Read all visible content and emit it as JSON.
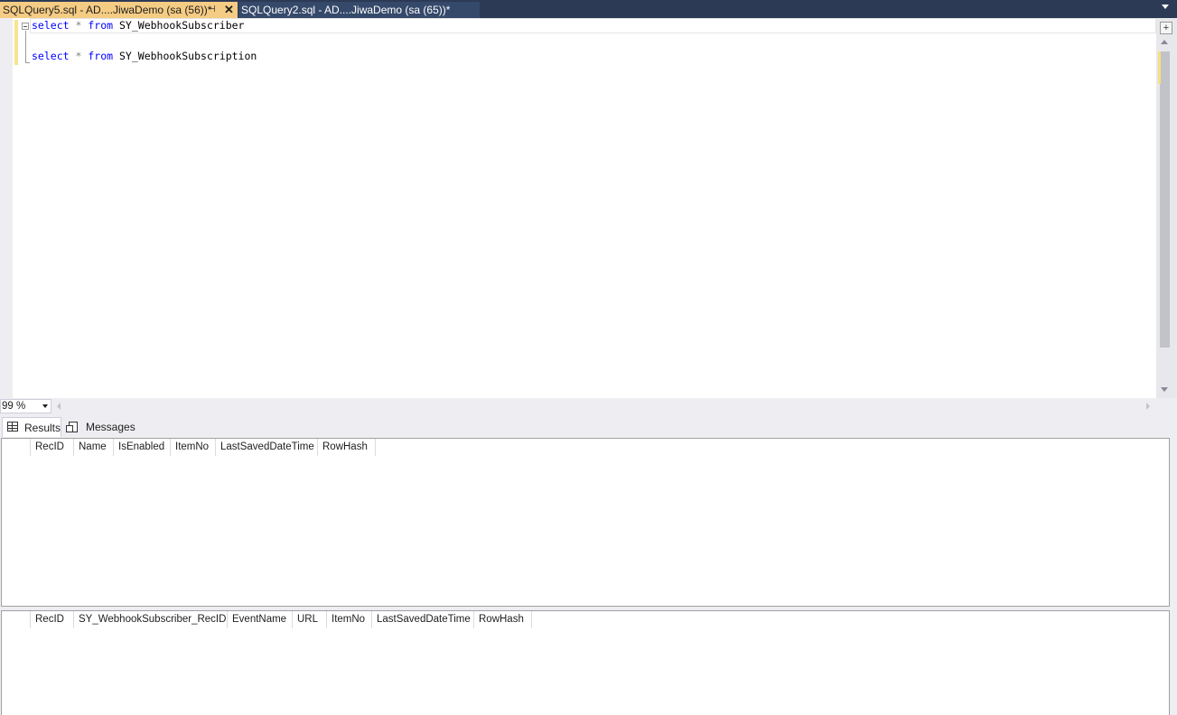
{
  "tabs": [
    {
      "title": "SQLQuery5.sql - AD....JiwaDemo (sa (56))*",
      "pin": "⊣",
      "close": "✕"
    },
    {
      "title": "SQLQuery2.sql - AD....JiwaDemo (sa (65))*"
    }
  ],
  "editor": {
    "lines": [
      {
        "kw1": "select",
        "op": "*",
        "kw2": "from",
        "table": "SY_WebhookSubscriber"
      },
      {
        "kw1": "select",
        "op": "*",
        "kw2": "from",
        "table": "SY_WebhookSubscription"
      }
    ]
  },
  "zoom": {
    "value": "99 %"
  },
  "results_tabs": {
    "results": "Results",
    "messages": "Messages"
  },
  "grid1": {
    "columns": [
      "RecID",
      "Name",
      "IsEnabled",
      "ItemNo",
      "LastSavedDateTime",
      "RowHash"
    ]
  },
  "grid2": {
    "columns": [
      "RecID",
      "SY_WebhookSubscriber_RecID",
      "EventName",
      "URL",
      "ItemNo",
      "LastSavedDateTime",
      "RowHash"
    ]
  },
  "colors": {
    "active_tab": "#f5cc84",
    "tab_strip": "#2d3a56",
    "keyword": "#0000ff"
  }
}
